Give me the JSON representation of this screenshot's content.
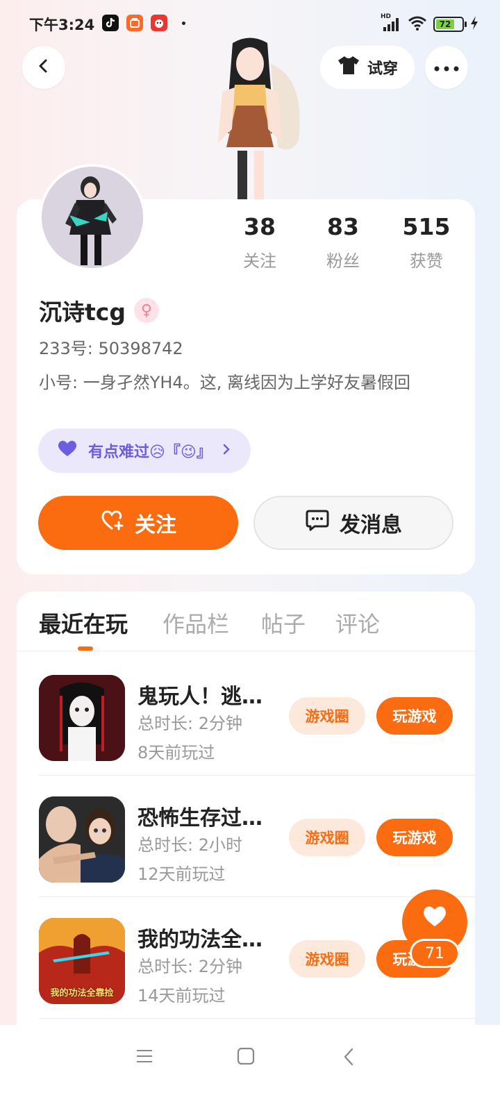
{
  "status_bar": {
    "time": "下午3:24",
    "network_badge": "HD",
    "battery": "72",
    "battery_level": 0.72
  },
  "header": {
    "back_icon": "back-chevron-icon",
    "tryon_label": "试穿",
    "more_icon": "more-dots-icon"
  },
  "profile": {
    "stats": [
      {
        "value": "38",
        "label": "关注"
      },
      {
        "value": "83",
        "label": "粉丝"
      },
      {
        "value": "515",
        "label": "获赞"
      }
    ],
    "name": "沉诗tcg",
    "gender_icon": "female-icon",
    "uid": "233号: 50398742",
    "bio": "小号: 一身孑然YH4。这, 离线因为上学好友暑假回",
    "mood": "有点难过😥『😉』",
    "follow_label": "关注",
    "message_label": "发消息"
  },
  "tabs": [
    {
      "label": "最近在玩",
      "active": true
    },
    {
      "label": "作品栏",
      "active": false
    },
    {
      "label": "帖子",
      "active": false
    },
    {
      "label": "评论",
      "active": false
    }
  ],
  "games": [
    {
      "title": "鬼玩人！逃…",
      "duration": "总时长: 2分钟",
      "last_played": "8天前玩过",
      "circle_label": "游戏圈",
      "play_label": "玩游戏"
    },
    {
      "title": "恐怖生存过…",
      "duration": "总时长: 2小时",
      "last_played": "12天前玩过",
      "circle_label": "游戏圈",
      "play_label": "玩游戏"
    },
    {
      "title": "我的功法全…",
      "duration": "总时长: 2分钟",
      "last_played": "14天前玩过",
      "circle_label": "游戏圈",
      "play_label": "玩游戏",
      "icon_text": "我的功法全靠捡"
    }
  ],
  "like_fab": {
    "count": "71"
  },
  "colors": {
    "accent": "#fb6b10",
    "mood": "#6d5de0"
  }
}
